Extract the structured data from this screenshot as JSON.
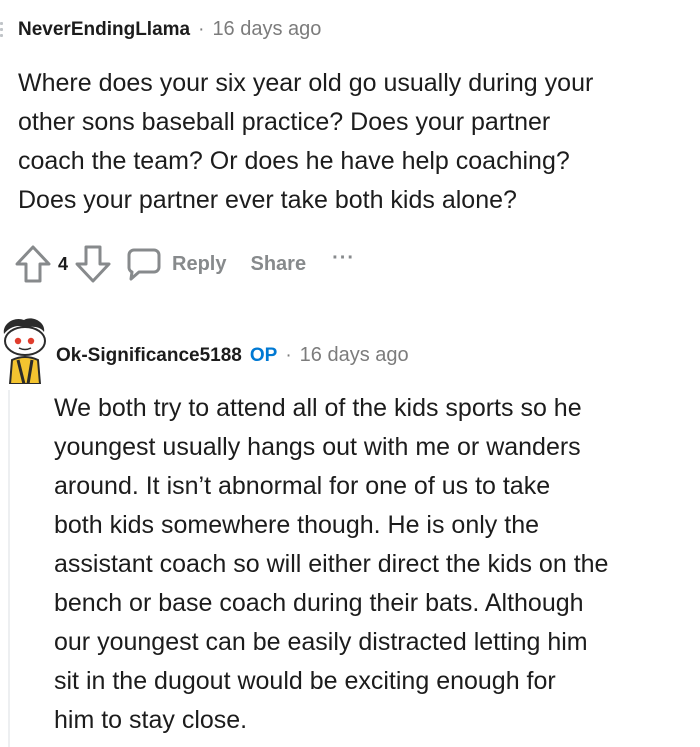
{
  "comment1": {
    "username": "NeverEndingLlama",
    "separator": "·",
    "timestamp": "16 days ago",
    "lines": [
      "Where does your six year old go usually during your",
      "other sons baseball practice? Does your partner",
      "coach the team? Or does he have help coaching?",
      "Does your partner ever take both kids alone?"
    ],
    "vote_count": "4",
    "reply_label": "Reply",
    "share_label": "Share",
    "more_label": "···",
    "icons": {
      "upvote": "upvote-arrow-icon",
      "downvote": "downvote-arrow-icon",
      "reply": "speech-bubble-icon"
    }
  },
  "comment2": {
    "username": "Ok-Significance5188",
    "op_badge": "OP",
    "separator": "·",
    "timestamp": "16 days ago",
    "lines": [
      "We both try to attend all of the kids sports so he",
      "youngest usually hangs out with me or wanders",
      "around. It isn’t abnormal for one of us to take",
      "both kids somewhere though. He is only the",
      "assistant coach so will either direct the kids on the",
      "bench or base coach during their bats. Although",
      "our youngest can be easily distracted letting him",
      "sit in the dugout would be exciting enough for",
      "him to stay close."
    ],
    "avatar": "snoo-avatar-icon"
  },
  "colors": {
    "op_badge": "#0079d3",
    "meta_gray": "#7c7c7c",
    "action_gray": "#878a8c",
    "thread_line": "#edeff1"
  }
}
